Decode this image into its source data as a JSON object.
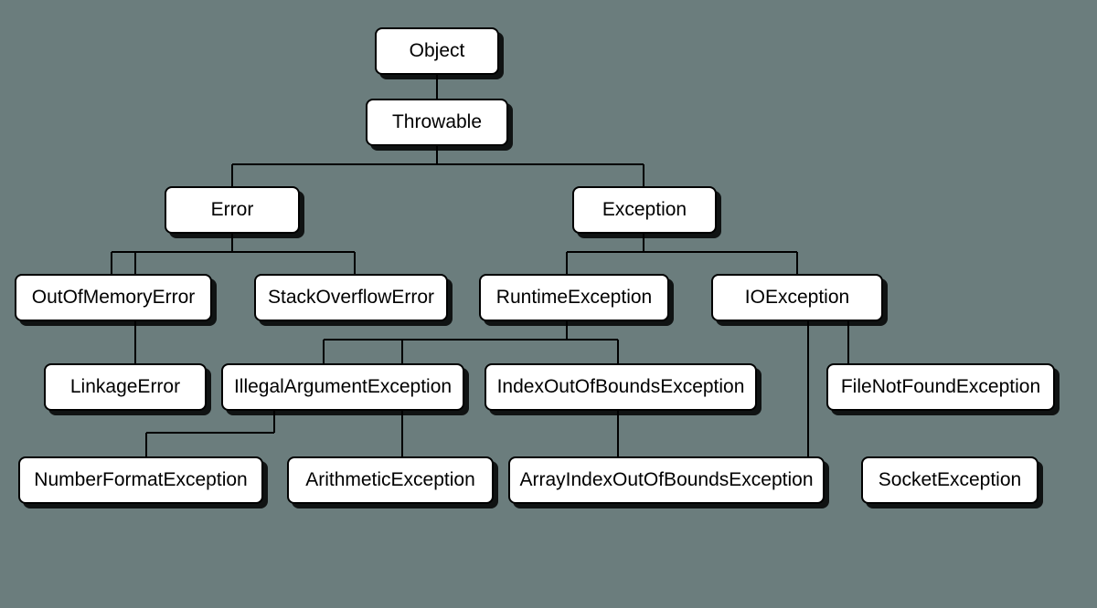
{
  "nodes": {
    "object": "Object",
    "throwable": "Throwable",
    "error": "Error",
    "exception": "Exception",
    "outOfMemoryError": "OutOfMemoryError",
    "stackOverflowError": "StackOverflowError",
    "runtimeException": "RuntimeException",
    "ioException": "IOException",
    "linkageError": "LinkageError",
    "illegalArgumentException": "IllegalArgumentException",
    "indexOutOfBoundsException": "IndexOutOfBoundsException",
    "fileNotFoundException": "FileNotFoundException",
    "numberFormatException": "NumberFormatException",
    "arithmeticException": "ArithmeticException",
    "arrayIndexOutOfBoundsException": "ArrayIndexOutOfBoundsException",
    "socketException": "SocketException"
  },
  "hierarchy": {
    "Object": [
      "Throwable"
    ],
    "Throwable": [
      "Error",
      "Exception"
    ],
    "Error": [
      "OutOfMemoryError",
      "StackOverflowError",
      "LinkageError"
    ],
    "Exception": [
      "RuntimeException",
      "IOException"
    ],
    "RuntimeException": [
      "IllegalArgumentException",
      "IndexOutOfBoundsException",
      "ArithmeticException"
    ],
    "IOException": [
      "FileNotFoundException",
      "SocketException"
    ],
    "IllegalArgumentException": [
      "NumberFormatException"
    ],
    "IndexOutOfBoundsException": [
      "ArrayIndexOutOfBoundsException"
    ]
  }
}
